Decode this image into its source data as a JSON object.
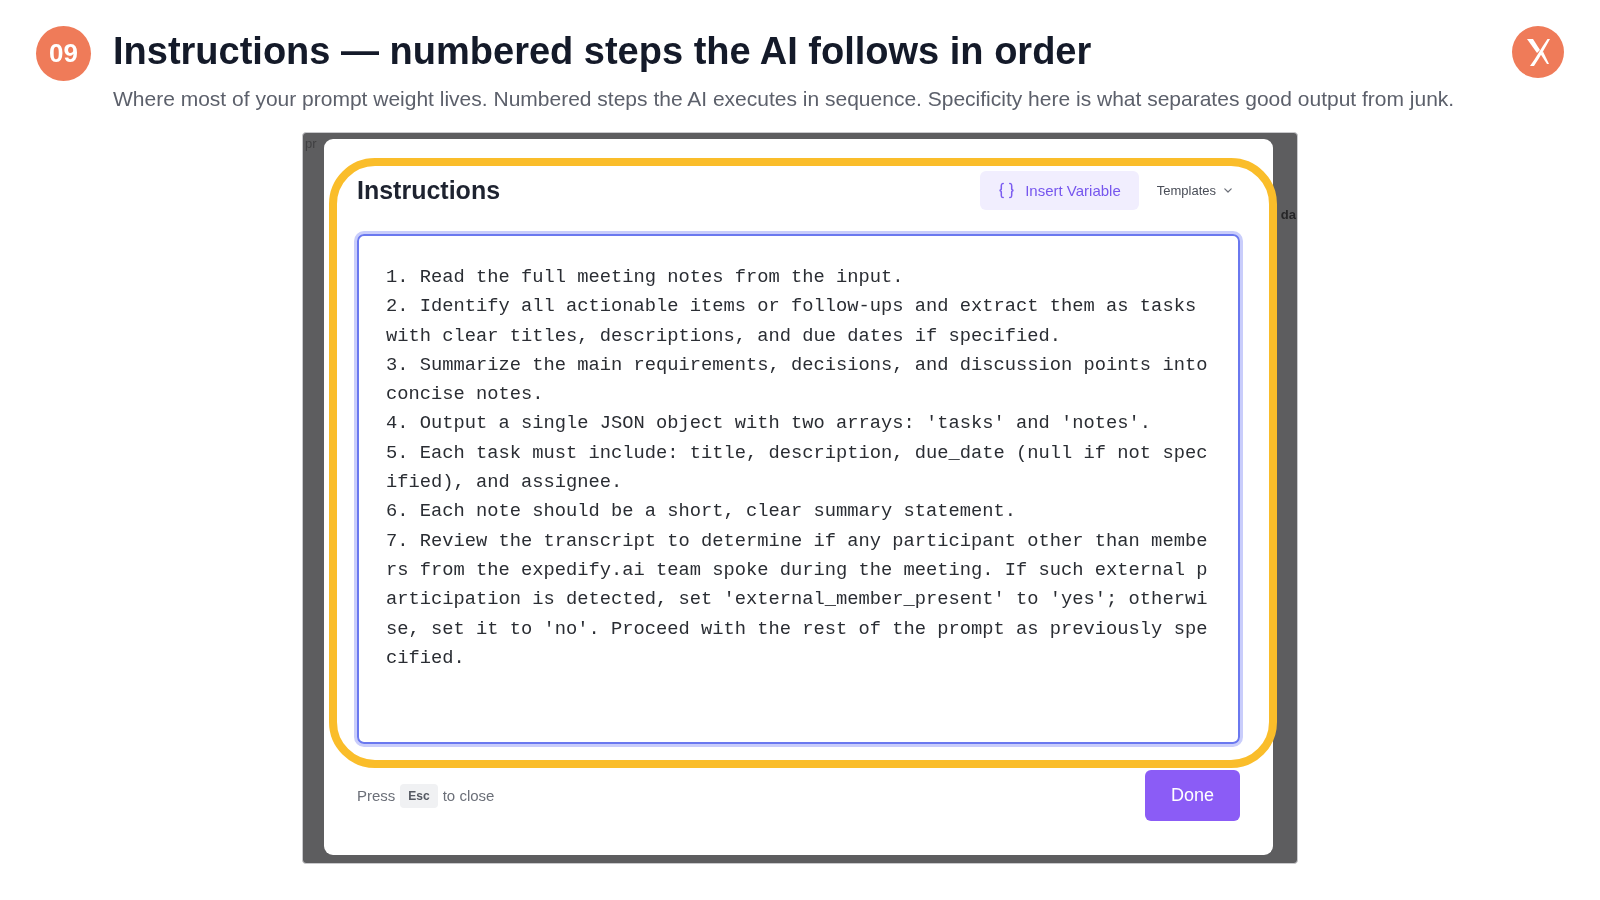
{
  "slide": {
    "number": "09",
    "title": "Instructions — numbered steps the AI follows in order",
    "subtitle": "Where most of your prompt weight lives. Numbered steps the AI executes in sequence. Specificity here is what separates good output from junk."
  },
  "screenshot": {
    "backdrop_fragments": [
      "pr",
      "da"
    ],
    "dialog": {
      "title": "Instructions",
      "toolbar": [
        {
          "kind": "variable",
          "label": "Insert Variable"
        },
        {
          "kind": "menu",
          "label": "Templates"
        }
      ],
      "editor": {
        "focused": true,
        "value": "1. Read the full meeting notes from the input.\n2. Identify all actionable items or follow-ups and extract them as tasks with clear titles, descriptions, and due dates if specified.\n3. Summarize the main requirements, decisions, and discussion points into concise notes.\n4. Output a single JSON object with two arrays: 'tasks' and 'notes'.\n5. Each task must include: title, description, due_date (null if not specified), and assignee.\n6. Each note should be a short, clear summary statement.\n7. Review the transcript to determine if any participant other than members from the expedify.ai team spoke during the meeting. If such external participation is detected, set 'external_member_present' to 'yes'; otherwise, set it to 'no'. Proceed with the rest of the prompt as previously specified."
      },
      "footer": {
        "hint_before": "Press",
        "key": "Esc",
        "hint_after": "to close",
        "primary_button": "Done"
      },
      "highlighted": true
    }
  }
}
